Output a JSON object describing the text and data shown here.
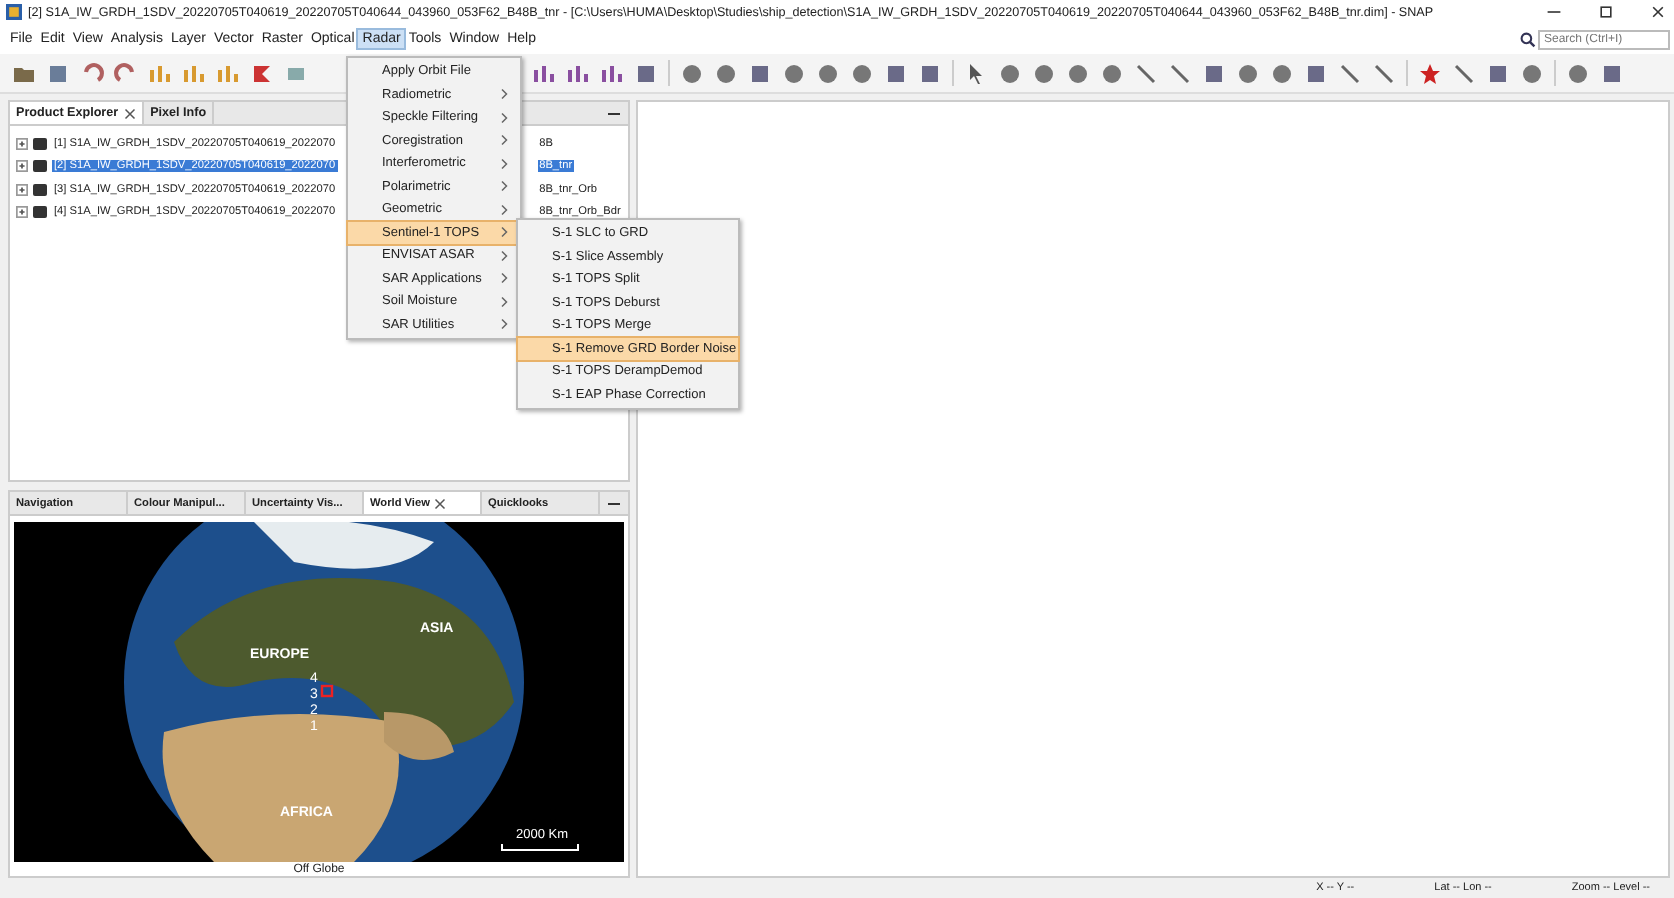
{
  "window": {
    "title": "[2] S1A_IW_GRDH_1SDV_20220705T040619_20220705T040644_043960_053F62_B48B_tnr - [C:\\Users\\HUMA\\Desktop\\Studies\\ship_detection\\S1A_IW_GRDH_1SDV_20220705T040619_20220705T040644_043960_053F62_B48B_tnr.dim] - SNAP"
  },
  "menubar": [
    {
      "label": "File",
      "selected": false
    },
    {
      "label": "Edit",
      "selected": false
    },
    {
      "label": "View",
      "selected": false
    },
    {
      "label": "Analysis",
      "selected": false
    },
    {
      "label": "Layer",
      "selected": false
    },
    {
      "label": "Vector",
      "selected": false
    },
    {
      "label": "Raster",
      "selected": false
    },
    {
      "label": "Optical",
      "selected": false
    },
    {
      "label": "Radar",
      "selected": true
    },
    {
      "label": "Tools",
      "selected": false
    },
    {
      "label": "Window",
      "selected": false
    },
    {
      "label": "Help",
      "selected": false
    }
  ],
  "search": {
    "placeholder": "Search (Ctrl+I)"
  },
  "product_explorer": {
    "tabs": [
      {
        "label": "Product Explorer",
        "selected": true,
        "closable": true
      },
      {
        "label": "Pixel Info",
        "selected": false,
        "closable": false
      }
    ],
    "products": [
      {
        "text_start": "[1] S1A_IW_GRDH_1SDV_20220705T040619_2022070",
        "text_end": "8B",
        "selected": false
      },
      {
        "text_start": "[2] S1A_IW_GRDH_1SDV_20220705T040619_2022070",
        "text_end": "8B_tnr",
        "selected": true
      },
      {
        "text_start": "[3] S1A_IW_GRDH_1SDV_20220705T040619_2022070",
        "text_end": "8B_tnr_Orb",
        "selected": false
      },
      {
        "text_start": "[4] S1A_IW_GRDH_1SDV_20220705T040619_2022070",
        "text_end": "8B_tnr_Orb_Bdr",
        "selected": false
      }
    ]
  },
  "radar_menu": [
    {
      "label": "Apply Orbit File",
      "submenu": false,
      "selected": false
    },
    {
      "label": "Radiometric",
      "submenu": true,
      "selected": false
    },
    {
      "label": "Speckle Filtering",
      "submenu": true,
      "selected": false
    },
    {
      "label": "Coregistration",
      "submenu": true,
      "selected": false
    },
    {
      "label": "Interferometric",
      "submenu": true,
      "selected": false
    },
    {
      "label": "Polarimetric",
      "submenu": true,
      "selected": false
    },
    {
      "label": "Geometric",
      "submenu": true,
      "selected": false
    },
    {
      "label": "Sentinel-1 TOPS",
      "submenu": true,
      "selected": true
    },
    {
      "label": "ENVISAT ASAR",
      "submenu": true,
      "selected": false
    },
    {
      "label": "SAR Applications",
      "submenu": true,
      "selected": false
    },
    {
      "label": "Soil Moisture",
      "submenu": true,
      "selected": false
    },
    {
      "label": "SAR Utilities",
      "submenu": true,
      "selected": false
    }
  ],
  "sentinel_submenu": [
    {
      "label": "S-1 SLC to GRD",
      "selected": false
    },
    {
      "label": "S-1 Slice Assembly",
      "selected": false
    },
    {
      "label": "S-1 TOPS Split",
      "selected": false
    },
    {
      "label": "S-1 TOPS Deburst",
      "selected": false
    },
    {
      "label": "S-1 TOPS Merge",
      "selected": false
    },
    {
      "label": "S-1 Remove GRD Border Noise",
      "selected": true
    },
    {
      "label": "S-1 TOPS DerampDemod",
      "selected": false
    },
    {
      "label": "S-1 EAP Phase Correction",
      "selected": false
    }
  ],
  "bottom_panel": {
    "tabs": [
      {
        "label": "Navigation",
        "selected": false,
        "closable": false
      },
      {
        "label": "Colour Manipul...",
        "selected": false,
        "closable": false
      },
      {
        "label": "Uncertainty Vis...",
        "selected": false,
        "closable": false
      },
      {
        "label": "World View",
        "selected": true,
        "closable": true
      },
      {
        "label": "Quicklooks",
        "selected": false,
        "closable": false
      }
    ],
    "map_labels": [
      "EUROPE",
      "ASIA",
      "AFRICA"
    ],
    "footprint_numbers": [
      "4",
      "3",
      "2",
      "1"
    ],
    "scale": "2000 Km",
    "status": "Off Globe"
  },
  "status_bar": [
    "X -- Y --",
    "Lat -- Lon --",
    "Zoom -- Level --"
  ]
}
